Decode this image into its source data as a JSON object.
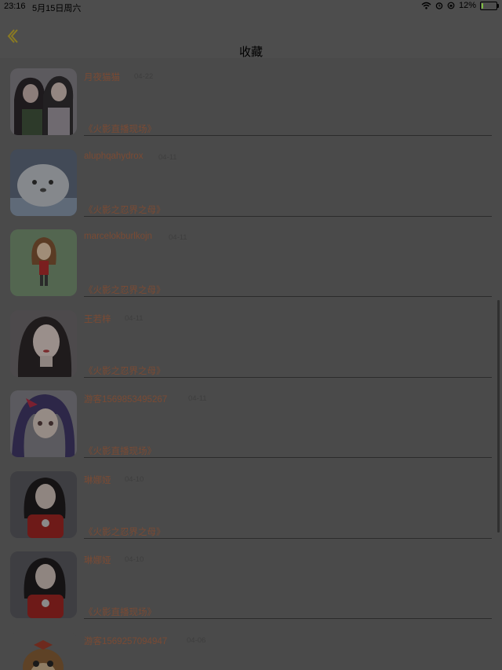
{
  "status_bar": {
    "time": "23:16",
    "date": "5月15日周六",
    "battery": "12%",
    "battery_level": 0.12,
    "icons": [
      "wifi-icon",
      "alarm-icon",
      "orientation-lock-icon",
      "battery-icon"
    ]
  },
  "nav": {
    "title": "收藏",
    "back_icon": "chevron-left-icon",
    "accent": "#8a7a22"
  },
  "items": [
    {
      "name": "月夜猫猫",
      "date": "04-22",
      "source": "《火影直播现场》",
      "avatar": "anime-girls-avatar"
    },
    {
      "name": "aluphqahydrox",
      "date": "04-11",
      "source": "《火影之忍界之母》",
      "avatar": "seal-avatar"
    },
    {
      "name": "marcelokburlkojn",
      "date": "04-11",
      "source": "《火影之忍界之母》",
      "avatar": "cartoon-girl-avatar"
    },
    {
      "name": "王若梓",
      "date": "04-11",
      "source": "《火影之忍界之母》",
      "avatar": "woman-portrait-avatar"
    },
    {
      "name": "游客1569853495267",
      "date": "04-11",
      "source": "《火影直播现场》",
      "avatar": "anime-purple-hair-avatar"
    },
    {
      "name": "琳娜娅",
      "date": "04-10",
      "source": "《火影之忍界之母》",
      "avatar": "girl-red-shirt-avatar"
    },
    {
      "name": "琳娜娅",
      "date": "04-10",
      "source": "《火影直播现场》",
      "avatar": "girl-red-shirt-avatar"
    },
    {
      "name": "游客1569257094947",
      "date": "04-06",
      "source": "",
      "avatar": "cartoon-hamster-avatar"
    }
  ]
}
